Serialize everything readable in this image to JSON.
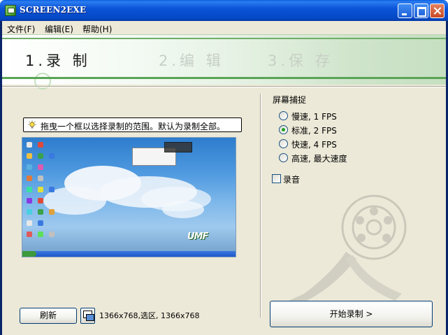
{
  "window": {
    "title": "SCREEN2EXE"
  },
  "menu": {
    "items": [
      "文件(F)",
      "编辑(E)",
      "帮助(H)"
    ]
  },
  "steps": [
    {
      "label": "1.录 制",
      "active": true
    },
    {
      "label": "2.编 辑",
      "active": false
    },
    {
      "label": "3.保 存",
      "active": false
    }
  ],
  "hint": {
    "text": "拖曳一个框以选择录制的范围。默认为录制全部。"
  },
  "preview": {
    "logo": "UMF"
  },
  "bottom": {
    "refresh_label": "刷新",
    "resolution_text": "1366x768,选区, 1366x768"
  },
  "capture": {
    "group_title": "屏幕捕捉",
    "options": [
      {
        "label": "慢速, 1 FPS",
        "checked": false
      },
      {
        "label": "标准, 2 FPS",
        "checked": true
      },
      {
        "label": "快速, 4 FPS",
        "checked": false
      },
      {
        "label": "高速, 最大速度",
        "checked": false
      }
    ],
    "record_audio_label": "录音",
    "record_audio_checked": false
  },
  "start_button": {
    "label": "开始录制 >"
  },
  "colors": {
    "title_bar": "#0b55d9",
    "header_green": "#5aa455",
    "close_button": "#c84a25"
  }
}
